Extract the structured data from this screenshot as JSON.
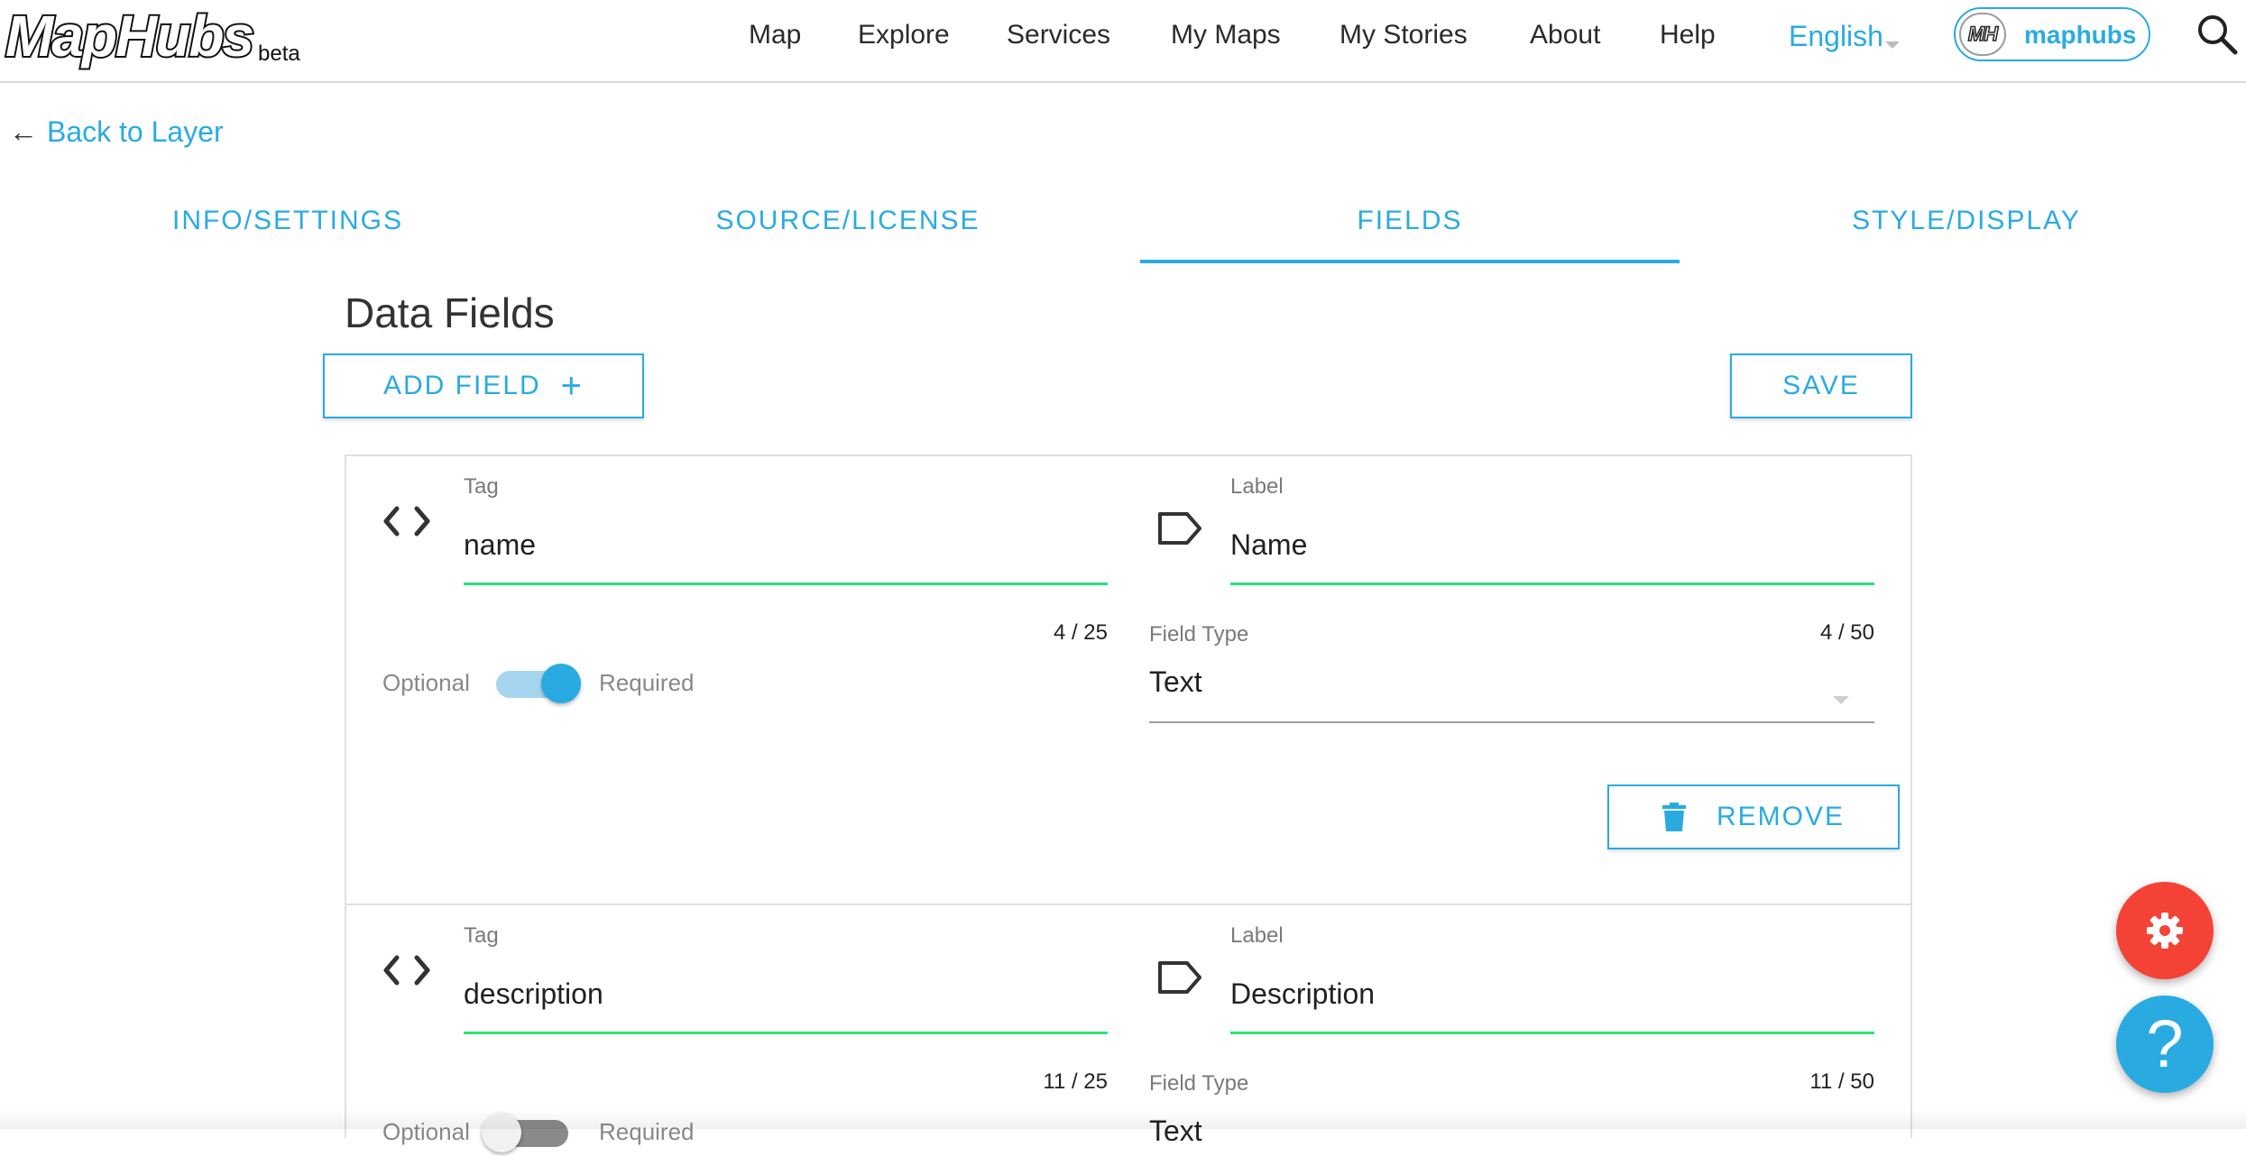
{
  "header": {
    "logo_text": "MapHubs",
    "beta_label": "beta",
    "nav": [
      "Map",
      "Explore",
      "Services",
      "My Maps",
      "My Stories",
      "About",
      "Help"
    ],
    "language": "English",
    "account": {
      "avatar_text": "MH",
      "username": "maphubs"
    },
    "search_icon": "search-icon"
  },
  "back_link": {
    "arrow": "←",
    "label": "Back to Layer"
  },
  "tabs": [
    {
      "label": "INFO/SETTINGS",
      "active": false
    },
    {
      "label": "SOURCE/LICENSE",
      "active": false
    },
    {
      "label": "FIELDS",
      "active": true
    },
    {
      "label": "STYLE/DISPLAY",
      "active": false
    }
  ],
  "page_title": "Data Fields",
  "toolbar": {
    "add_field_label": "ADD FIELD",
    "add_icon": "+",
    "save_label": "SAVE"
  },
  "fields": [
    {
      "tag_label": "Tag",
      "tag_value": "name",
      "tag_counter": "4 / 25",
      "label_label": "Label",
      "label_value": "Name",
      "label_counter": "4 / 50",
      "optional_label": "Optional",
      "required_label": "Required",
      "required": true,
      "field_type_label": "Field Type",
      "field_type_value": "Text",
      "remove_label": "REMOVE"
    },
    {
      "tag_label": "Tag",
      "tag_value": "description",
      "tag_counter": "11 / 25",
      "label_label": "Label",
      "label_value": "Description",
      "label_counter": "11 / 50",
      "optional_label": "Optional",
      "required_label": "Required",
      "required": false,
      "field_type_label": "Field Type",
      "field_type_value": "Text"
    }
  ],
  "fab": {
    "settings_icon": "gear-icon",
    "help_text": "?"
  },
  "colors": {
    "accent": "#29abe2",
    "valid_underline": "#2ee07a",
    "settings_fab": "#f44336"
  }
}
